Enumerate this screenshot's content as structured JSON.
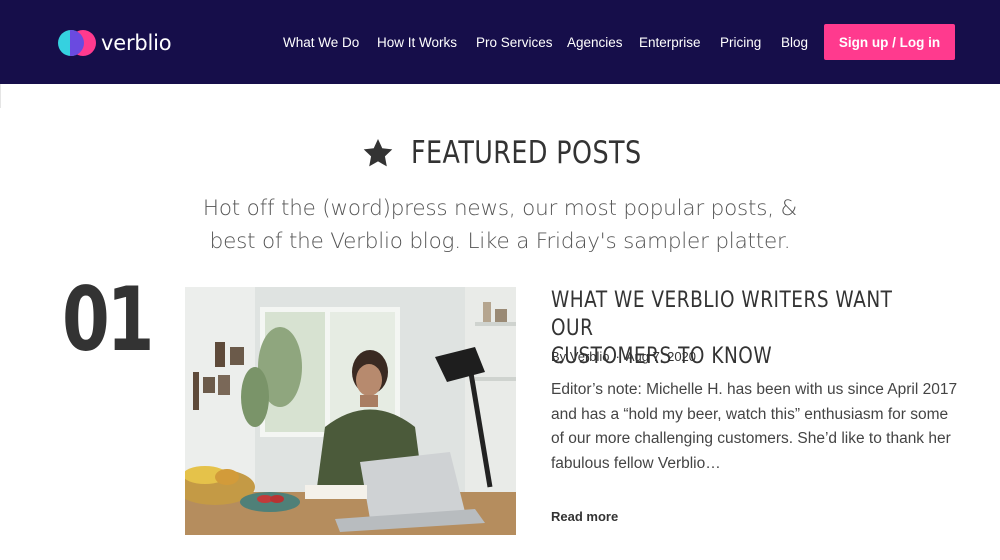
{
  "nav": {
    "logo_text": "verblio",
    "items": [
      {
        "label": "What We Do"
      },
      {
        "label": "How It Works"
      },
      {
        "label": "Pro Services"
      },
      {
        "label": "Agencies"
      },
      {
        "label": "Enterprise"
      },
      {
        "label": "Pricing"
      },
      {
        "label": "Blog"
      }
    ],
    "cta_label": "Sign up / Log in",
    "background": "#160e4a",
    "cta_color": "#ff3a8e"
  },
  "featured": {
    "icon": "star-icon",
    "title": "FEATURED POSTS",
    "subtitle_line1": "Hot off the (word)press news, our most popular posts, &",
    "subtitle_line2": "best of the Verblio blog. Like a Friday's sampler platter."
  },
  "post": {
    "number": "01",
    "title_line1": "WHAT WE VERBLIO WRITERS WANT OUR",
    "title_line2": "CUSTOMERS TO KNOW",
    "author": "By Verblio",
    "separator": "·",
    "date": "Aug 7, 2020",
    "excerpt": "Editor’s note: Michelle H. has been with us since April 2017 and has a “hold my beer, watch this” enthusiasm for some of our more challenging customers. She’d like to thank her fabulous fellow Verblio…",
    "read_more": "Read more"
  }
}
